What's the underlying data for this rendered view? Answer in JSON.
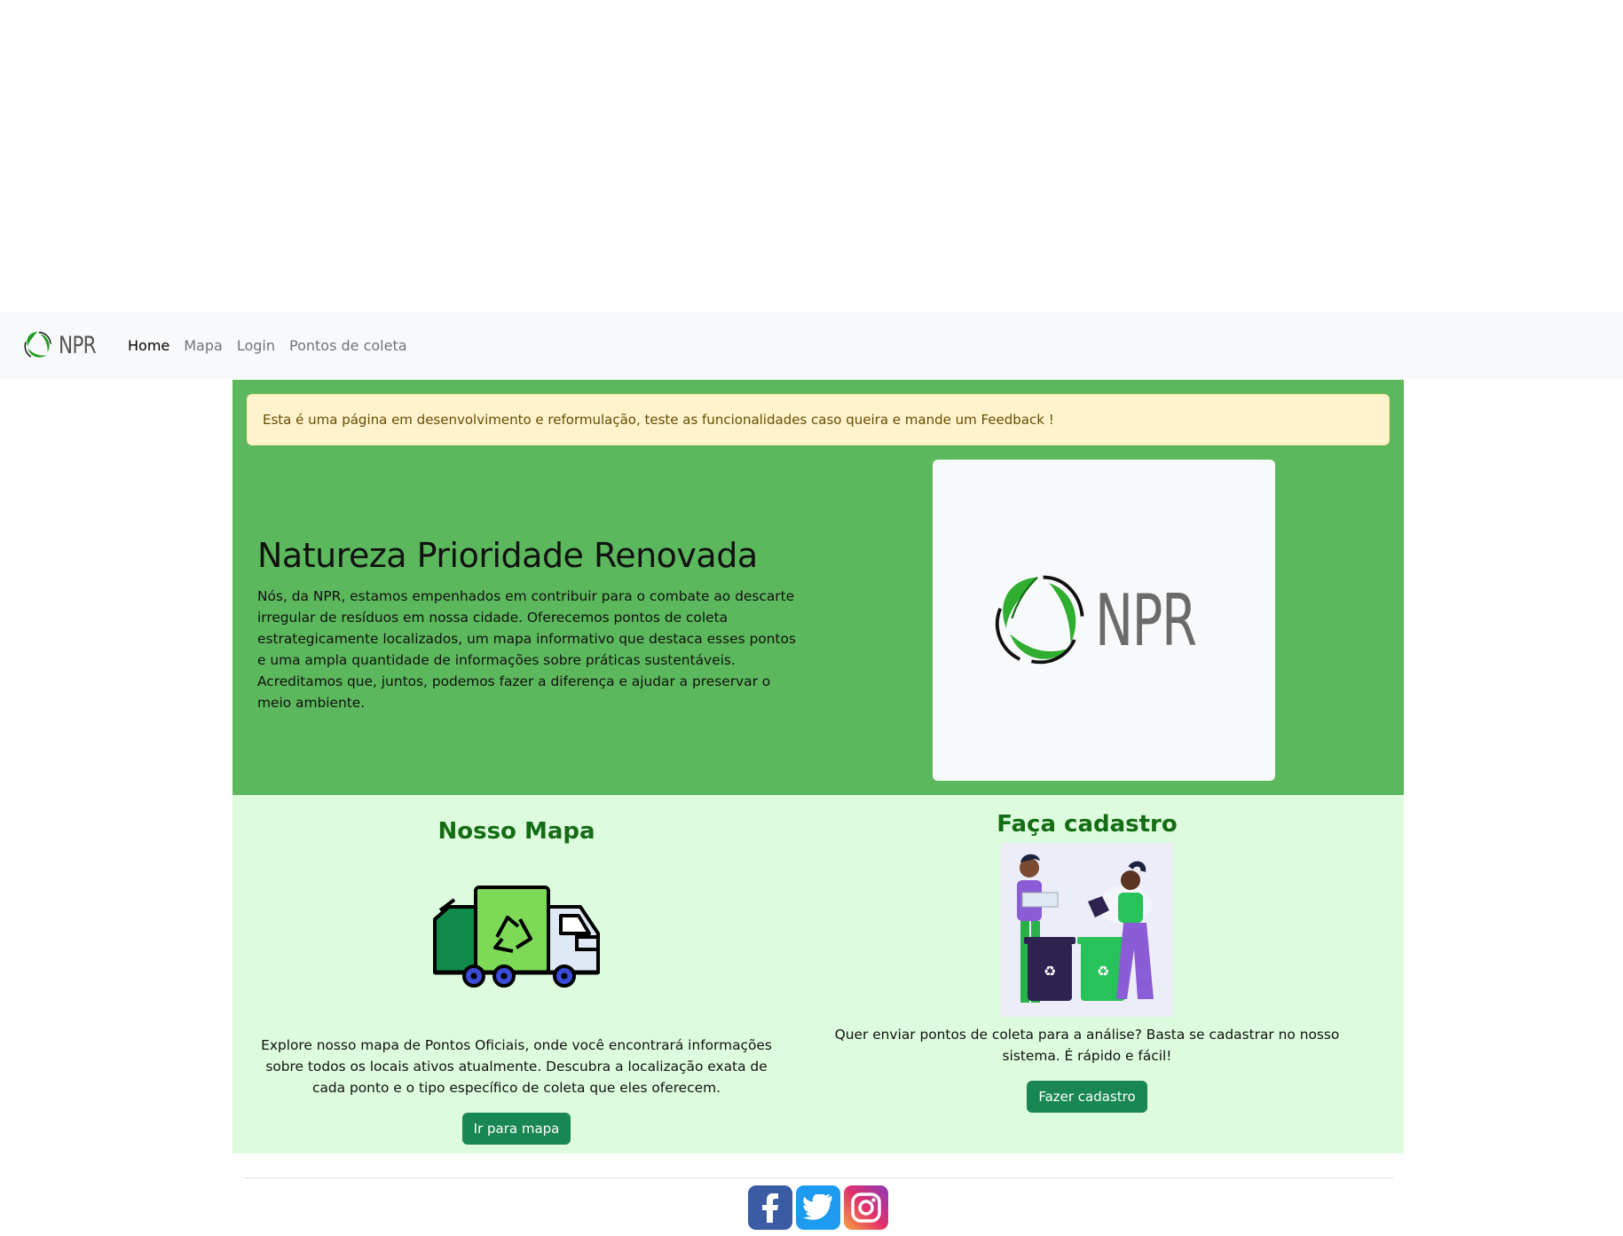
{
  "navbar": {
    "brand": "NPR",
    "links": [
      {
        "label": "Home",
        "active": true
      },
      {
        "label": "Mapa",
        "active": false
      },
      {
        "label": "Login",
        "active": false
      },
      {
        "label": "Pontos de coleta",
        "active": false
      }
    ]
  },
  "alert": {
    "text": "Esta é uma página em desenvolvimento e reformulação, teste as funcionalidades caso queira e mande um Feedback !"
  },
  "hero": {
    "title": "Natureza Prioridade Renovada",
    "description": "Nós, da NPR, estamos empenhados em contribuir para o combate ao descarte irregular de resíduos em nossa cidade. Oferecemos pontos de coleta estrategicamente localizados, um mapa informativo que destaca esses pontos e uma ampla quantidade de informações sobre práticas sustentáveis. Acreditamos que, juntos, podemos fazer a diferença e ajudar a preservar o meio ambiente.",
    "logo_text": "NPR"
  },
  "features": {
    "map": {
      "title": "Nosso Mapa",
      "text": "Explore nosso mapa de Pontos Oficiais, onde você encontrará informações sobre todos os locais ativos atualmente. Descubra a localização exata de cada ponto e o tipo específico de coleta que eles oferecem.",
      "button": "Ir para mapa",
      "icon": "recycling-truck-icon"
    },
    "signup": {
      "title": "Faça cadastro",
      "text": "Quer enviar pontos de coleta para a análise? Basta se cadastrar no nosso sistema. É rápido e fácil!",
      "button": "Fazer cadastro",
      "icon": "people-recycling-illustration"
    }
  },
  "footer": {
    "social": [
      "facebook-icon",
      "twitter-icon",
      "instagram-icon"
    ]
  },
  "colors": {
    "hero_bg": "#5cb85c",
    "features_bg": "#ddfcdd",
    "button": "#198754",
    "heading_green": "#146c14",
    "alert_bg": "#fff3cd"
  }
}
